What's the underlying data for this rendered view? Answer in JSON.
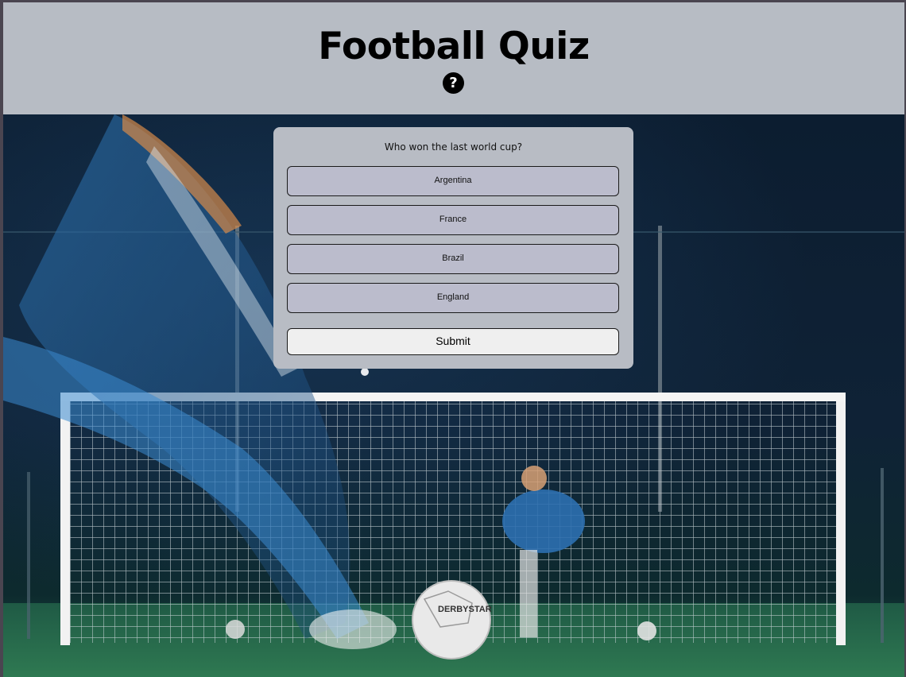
{
  "header": {
    "title": "Football Quiz",
    "help_icon": "question-mark-icon"
  },
  "quiz": {
    "question": "Who won the last world cup?",
    "answers": [
      "Argentina",
      "France",
      "Brazil",
      "England"
    ],
    "submit_label": "Submit"
  },
  "background": {
    "description_icon": "football-goal-photo",
    "ball_brand": "DERBYSTAR"
  },
  "colors": {
    "header_bg": "#b7bcc4",
    "card_bg": "#b8bcc4",
    "answer_bg": "#bbbccc",
    "submit_bg": "#efefef"
  }
}
